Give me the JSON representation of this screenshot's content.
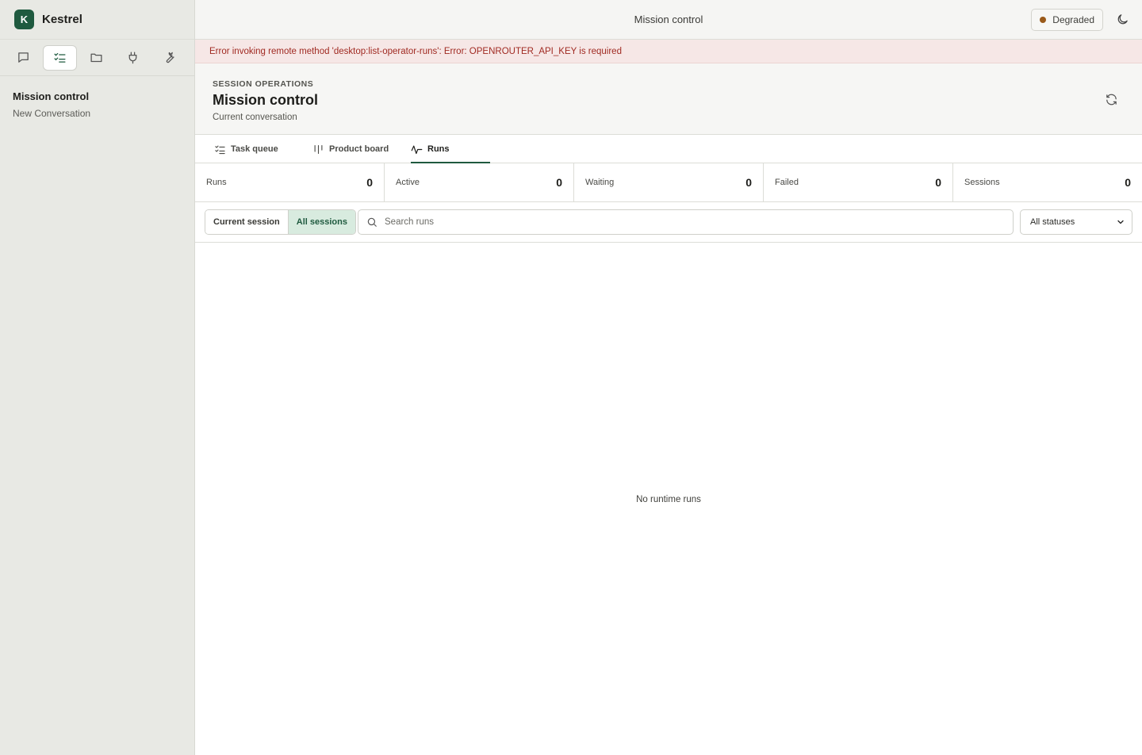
{
  "brand": {
    "logo_letter": "K",
    "name": "Kestrel"
  },
  "sidebar": {
    "nav_icons": [
      "chat-bubble-icon",
      "checklist-icon",
      "folder-icon",
      "plug-icon",
      "wrench-icon"
    ],
    "active_nav": "checklist-icon",
    "section_title": "Mission control",
    "items": [
      {
        "label": "New Conversation"
      }
    ]
  },
  "topbar": {
    "title": "Mission control",
    "status": {
      "label": "Degraded",
      "color": "#9a5a1a"
    },
    "theme_icon": "moon-icon"
  },
  "error_banner": "Error invoking remote method 'desktop:list-operator-runs': Error: OPENROUTER_API_KEY is required",
  "header": {
    "eyebrow": "SESSION OPERATIONS",
    "title": "Mission control",
    "subtitle": "Current conversation",
    "refresh_icon": "refresh-icon"
  },
  "tabs": [
    {
      "label": "Task queue",
      "icon": "task-list-icon",
      "active": false
    },
    {
      "label": "Product board",
      "icon": "board-columns-icon",
      "active": false
    },
    {
      "label": "Runs",
      "icon": "activity-icon",
      "active": true
    }
  ],
  "stats": [
    {
      "label": "Runs",
      "value": "0"
    },
    {
      "label": "Active",
      "value": "0"
    },
    {
      "label": "Waiting",
      "value": "0"
    },
    {
      "label": "Failed",
      "value": "0"
    },
    {
      "label": "Sessions",
      "value": "0"
    }
  ],
  "filters": {
    "scope": [
      "Current session",
      "All sessions"
    ],
    "scope_selected": "All sessions",
    "search_placeholder": "Search runs",
    "status_selected": "All statuses"
  },
  "empty_state": "No runtime runs",
  "colors": {
    "accent": "#1f5a3f",
    "error_text": "#a02a22",
    "error_bg": "#f6e7e6"
  }
}
